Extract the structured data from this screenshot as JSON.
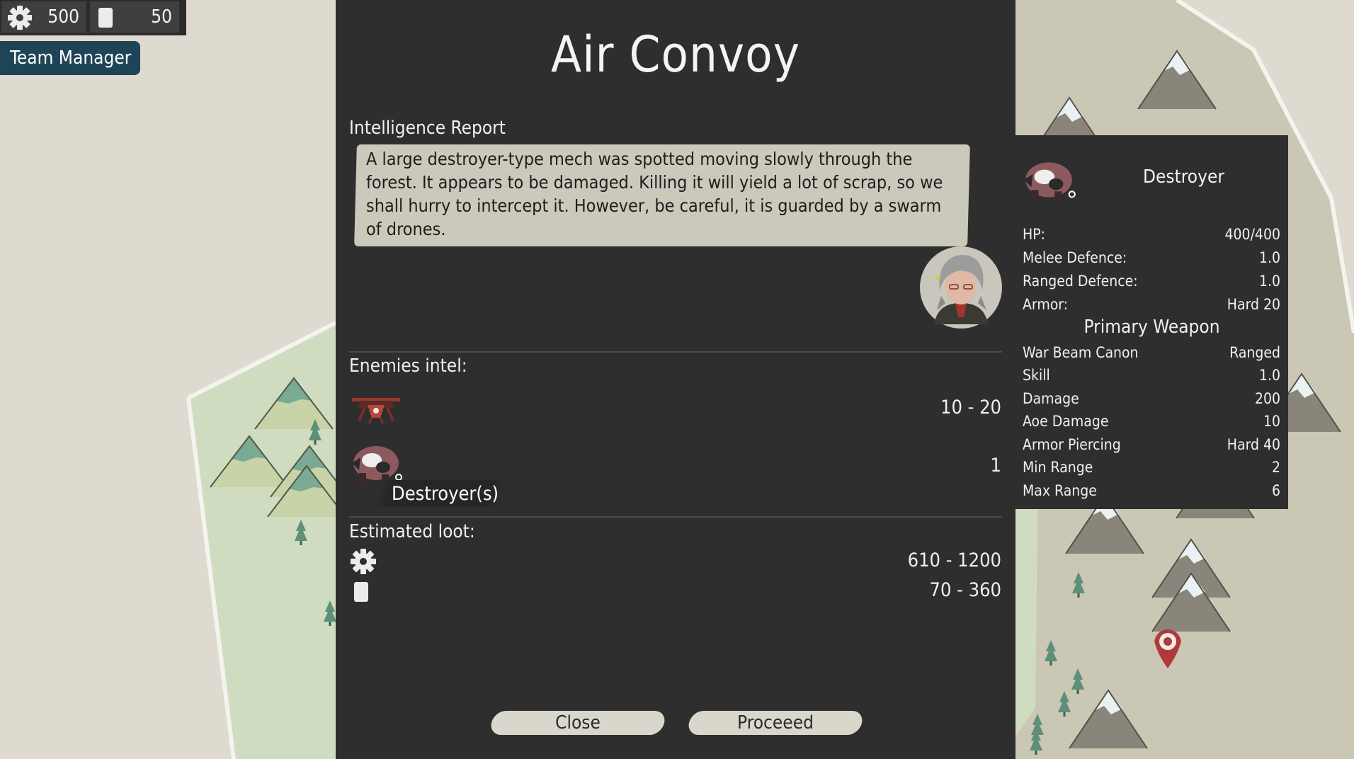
{
  "hud": {
    "gear_amount": "500",
    "scrap_amount": "50",
    "gear_icon": "gear-icon",
    "scrap_icon": "scrap-card-icon",
    "team_manager_label": "Team Manager"
  },
  "dialog": {
    "title": "Air Convoy",
    "report_label": "Intelligence Report",
    "report_text": "A large destroyer-type mech was spotted moving slowly through the forest. It appears to be damaged. Killing it will yield a lot of scrap, so we shall hurry to intercept it. However, be careful, it is guarded by a swarm of drones.",
    "enemies_label": "Enemies intel:",
    "enemies": [
      {
        "icon": "drone-icon",
        "count": "10 - 20"
      },
      {
        "icon": "destroyer-mech-icon",
        "count": "1",
        "name": "Destroyer(s)"
      }
    ],
    "loot_label": "Estimated loot:",
    "loot": [
      {
        "icon": "gear-icon",
        "range": "610 - 1200"
      },
      {
        "icon": "scrap-card-icon",
        "range": "70 - 360"
      }
    ],
    "close_label": "Close",
    "proceed_label": "Proceeed"
  },
  "info_panel": {
    "name": "Destroyer",
    "stats": [
      {
        "k": "HP:",
        "v": "400/400"
      },
      {
        "k": "Melee Defence:",
        "v": "1.0"
      },
      {
        "k": "Ranged Defence:",
        "v": "1.0"
      },
      {
        "k": "Armor:",
        "v": "Hard 20"
      }
    ],
    "weapon_title": "Primary Weapon",
    "weapon": [
      {
        "k": "War Beam Canon",
        "v": "Ranged"
      },
      {
        "k": "Skill",
        "v": "1.0"
      },
      {
        "k": "Damage",
        "v": "200"
      },
      {
        "k": "Aoe Damage",
        "v": "10"
      },
      {
        "k": "Armor Piercing",
        "v": "Hard 40"
      },
      {
        "k": "Min Range",
        "v": "2"
      },
      {
        "k": "Max Range",
        "v": "6"
      }
    ]
  },
  "colors": {
    "panel": "#2e2e2e",
    "map_base": "#dedad0",
    "forest": "#cfdcc0",
    "button": "#d9d7cb",
    "team_button": "#1f4457",
    "marker": "#b03a3a"
  }
}
